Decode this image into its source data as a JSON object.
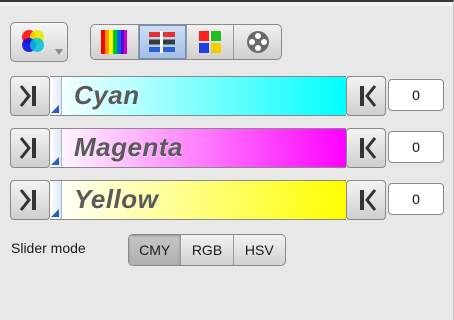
{
  "toolbar": {
    "color_model_icon": "color-wheel-icon",
    "dropdown_icon": "chevron-down-icon",
    "modes": [
      {
        "icon": "color-bars-icon",
        "active": false
      },
      {
        "icon": "sliders-icon",
        "active": true
      },
      {
        "icon": "color-swatches-icon",
        "active": false
      },
      {
        "icon": "color-circles-icon",
        "active": false
      }
    ]
  },
  "sliders": [
    {
      "label": "Cyan",
      "value": "0",
      "gradient_from": "#ffffff",
      "gradient_to": "#00ffff"
    },
    {
      "label": "Magenta",
      "value": "0",
      "gradient_from": "#ffffff",
      "gradient_to": "#ff00ff"
    },
    {
      "label": "Yellow",
      "value": "0",
      "gradient_from": "#ffffff",
      "gradient_to": "#ffff00"
    }
  ],
  "slider_mode": {
    "label": "Slider mode",
    "options": [
      "CMY",
      "RGB",
      "HSV"
    ],
    "selected": "CMY"
  }
}
